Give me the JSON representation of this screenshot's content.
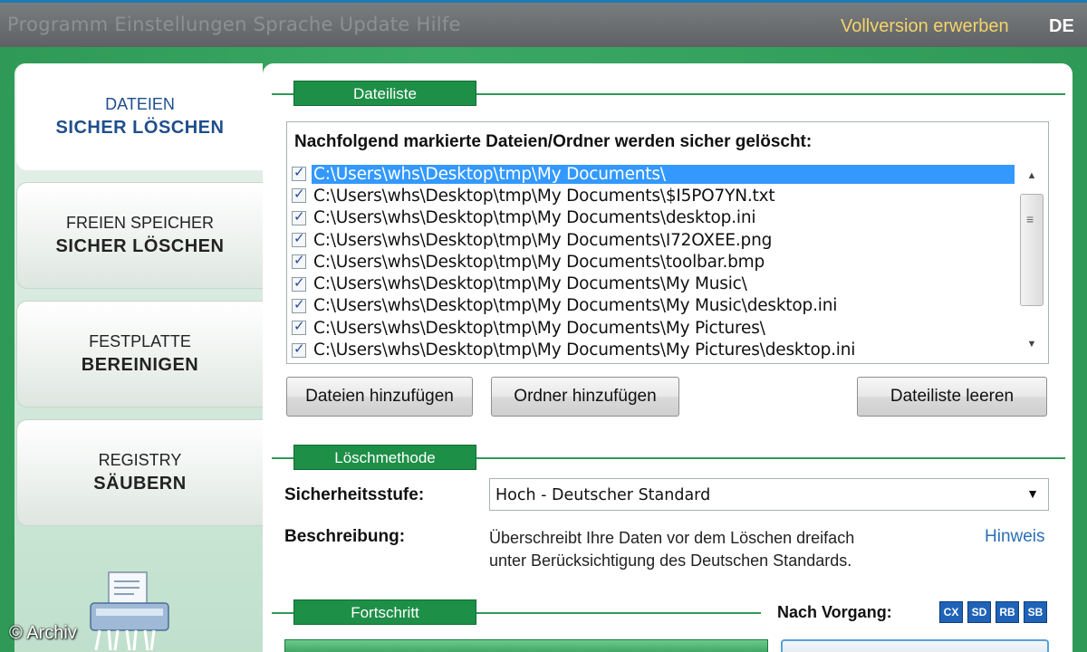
{
  "topbar": {
    "menu_faded": "Programm   Einstellungen   Sprache   Update   Hilfe",
    "buy_link": "Vollversion erwerben",
    "language": "DE"
  },
  "sidebar": {
    "items": [
      {
        "line1": "DATEIEN",
        "line2": "SICHER LÖSCHEN",
        "active": true
      },
      {
        "line1": "FREIEN SPEICHER",
        "line2": "SICHER LÖSCHEN",
        "active": false
      },
      {
        "line1": "FESTPLATTE",
        "line2": "BEREINIGEN",
        "active": false
      },
      {
        "line1": "REGISTRY",
        "line2": "SÄUBERN",
        "active": false
      }
    ]
  },
  "copyright": "© Archiv",
  "filelist": {
    "section_title": "Dateiliste",
    "heading": "Nachfolgend markierte Dateien/Ordner werden sicher gelöscht:",
    "rows": [
      {
        "path": "C:\\Users\\whs\\Desktop\\tmp\\My Documents\\",
        "checked": true,
        "selected": true
      },
      {
        "path": "C:\\Users\\whs\\Desktop\\tmp\\My Documents\\$I5PO7YN.txt",
        "checked": true,
        "selected": false
      },
      {
        "path": "C:\\Users\\whs\\Desktop\\tmp\\My Documents\\desktop.ini",
        "checked": true,
        "selected": false
      },
      {
        "path": "C:\\Users\\whs\\Desktop\\tmp\\My Documents\\I72OXEE.png",
        "checked": true,
        "selected": false
      },
      {
        "path": "C:\\Users\\whs\\Desktop\\tmp\\My Documents\\toolbar.bmp",
        "checked": true,
        "selected": false
      },
      {
        "path": "C:\\Users\\whs\\Desktop\\tmp\\My Documents\\My Music\\",
        "checked": true,
        "selected": false
      },
      {
        "path": "C:\\Users\\whs\\Desktop\\tmp\\My Documents\\My Music\\desktop.ini",
        "checked": true,
        "selected": false
      },
      {
        "path": "C:\\Users\\whs\\Desktop\\tmp\\My Documents\\My Pictures\\",
        "checked": true,
        "selected": false
      },
      {
        "path": "C:\\Users\\whs\\Desktop\\tmp\\My Documents\\My Pictures\\desktop.ini",
        "checked": true,
        "selected": false
      }
    ],
    "buttons": {
      "add_files": "Dateien hinzufügen",
      "add_folder": "Ordner hinzufügen",
      "clear_list": "Dateiliste leeren"
    }
  },
  "method": {
    "section_title": "Löschmethode",
    "security_label": "Sicherheitsstufe:",
    "security_value": "Hoch - Deutscher Standard",
    "description_label": "Beschreibung:",
    "description_line1": "Überschreibt Ihre Daten vor dem Löschen dreifach",
    "description_line2": "unter Berücksichtigung des Deutschen Standards.",
    "hint_link": "Hinweis"
  },
  "progress": {
    "section_title": "Fortschritt",
    "after_label": "Nach Vorgang:",
    "after_options": [
      "CX",
      "SD",
      "RB",
      "SB"
    ]
  },
  "colors": {
    "brand_green": "#2f9a57",
    "section_green": "#1d8f47",
    "selection_blue": "#3399ff",
    "link_blue": "#2a6fb5",
    "buy_gold": "#f3d36a"
  }
}
